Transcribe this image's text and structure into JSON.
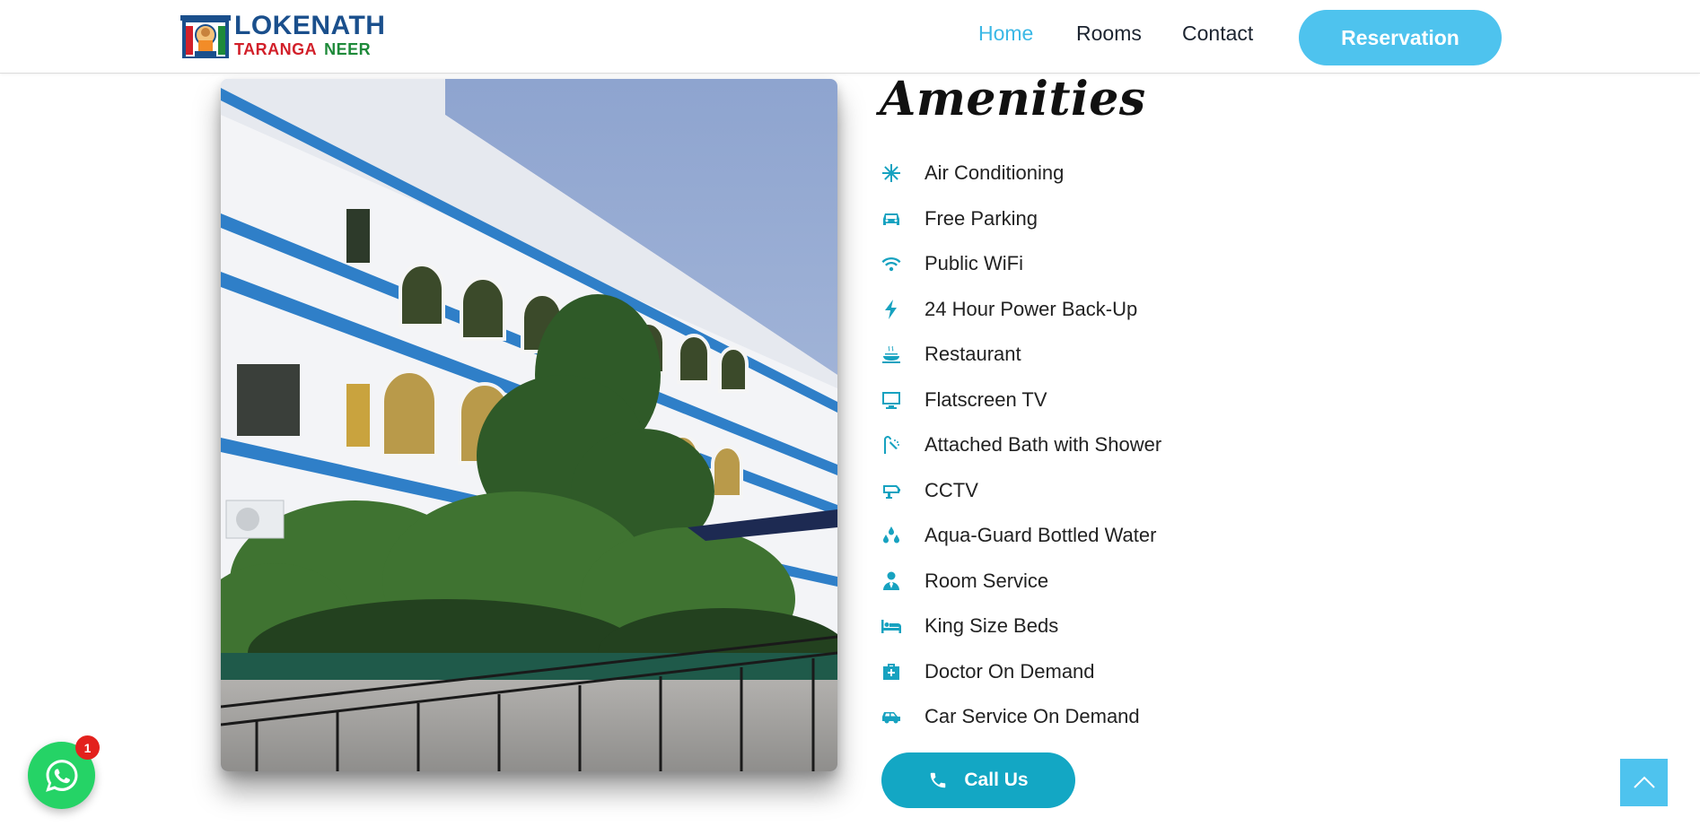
{
  "header": {
    "logo": {
      "line1": "LOKENATH",
      "line2_word1": "TARANGA",
      "line2_word2": "NEER"
    },
    "nav": [
      {
        "label": "Home",
        "active": true
      },
      {
        "label": "Rooms",
        "active": false
      },
      {
        "label": "Contact",
        "active": false
      }
    ],
    "reservation_label": "Reservation"
  },
  "amenities": {
    "title": "Amenities",
    "items": [
      {
        "label": "Air Conditioning",
        "icon": "snowflake-icon"
      },
      {
        "label": "Free Parking",
        "icon": "car-icon"
      },
      {
        "label": "Public WiFi",
        "icon": "wifi-icon"
      },
      {
        "label": "24 Hour Power Back-Up",
        "icon": "bolt-icon"
      },
      {
        "label": "Restaurant",
        "icon": "hot-dish-icon"
      },
      {
        "label": "Flatscreen TV",
        "icon": "tv-icon"
      },
      {
        "label": "Attached Bath with Shower",
        "icon": "shower-icon"
      },
      {
        "label": "CCTV",
        "icon": "cctv-icon"
      },
      {
        "label": "Aqua-Guard Bottled Water",
        "icon": "water-drops-icon"
      },
      {
        "label": "Room Service",
        "icon": "waiter-icon"
      },
      {
        "label": "King Size Beds",
        "icon": "bed-icon"
      },
      {
        "label": "Doctor On Demand",
        "icon": "medical-kit-icon"
      },
      {
        "label": "Car Service On Demand",
        "icon": "car-side-icon"
      }
    ],
    "call_label": "Call Us"
  },
  "whatsapp": {
    "badge": "1"
  },
  "colors": {
    "accent": "#4ec3ee",
    "icon_teal": "#17a2c0",
    "call_button": "#13a7c4",
    "whatsapp": "#25d366",
    "badge_red": "#e3211d"
  }
}
